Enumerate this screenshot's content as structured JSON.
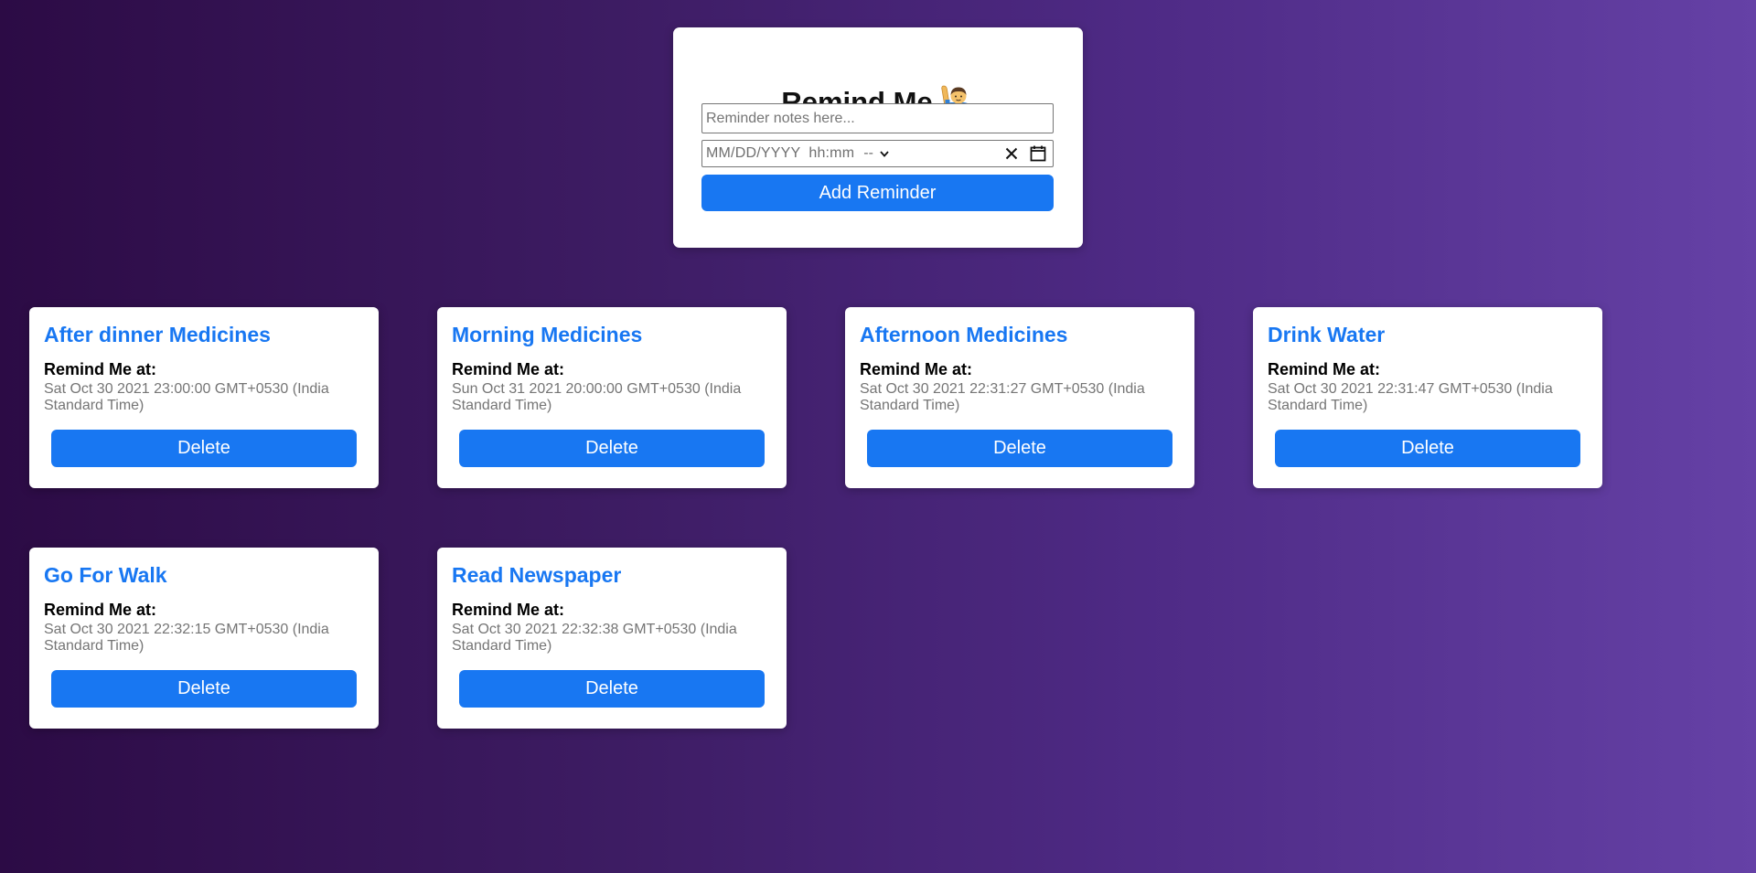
{
  "form": {
    "title": "Remind Me",
    "title_icon": "person-raising-hand-emoji",
    "notes_placeholder": "Reminder notes here...",
    "datetime_placeholder": "MM/DD/YYYY  hh:mm",
    "ampm_placeholder": "--",
    "add_button_label": "Add Reminder"
  },
  "reminders": [
    {
      "title": "After dinner Medicines",
      "label": "Remind Me at:",
      "time": "Sat Oct 30 2021 23:00:00 GMT+0530 (India Standard Time)",
      "delete_label": "Delete"
    },
    {
      "title": "Morning Medicines",
      "label": "Remind Me at:",
      "time": "Sun Oct 31 2021 20:00:00 GMT+0530 (India Standard Time)",
      "delete_label": "Delete"
    },
    {
      "title": "Afternoon Medicines",
      "label": "Remind Me at:",
      "time": "Sat Oct 30 2021 22:31:27 GMT+0530 (India Standard Time)",
      "delete_label": "Delete"
    },
    {
      "title": "Drink Water",
      "label": "Remind Me at:",
      "time": "Sat Oct 30 2021 22:31:47 GMT+0530 (India Standard Time)",
      "delete_label": "Delete"
    },
    {
      "title": "Go For Walk",
      "label": "Remind Me at:",
      "time": "Sat Oct 30 2021 22:32:15 GMT+0530 (India Standard Time)",
      "delete_label": "Delete"
    },
    {
      "title": "Read Newspaper",
      "label": "Remind Me at:",
      "time": "Sat Oct 30 2021 22:32:38 GMT+0530 (India Standard Time)",
      "delete_label": "Delete"
    }
  ],
  "colors": {
    "accent": "#1877f2",
    "background_start": "#2c0b45",
    "background_end": "#6541a6",
    "muted_text": "#757575"
  }
}
